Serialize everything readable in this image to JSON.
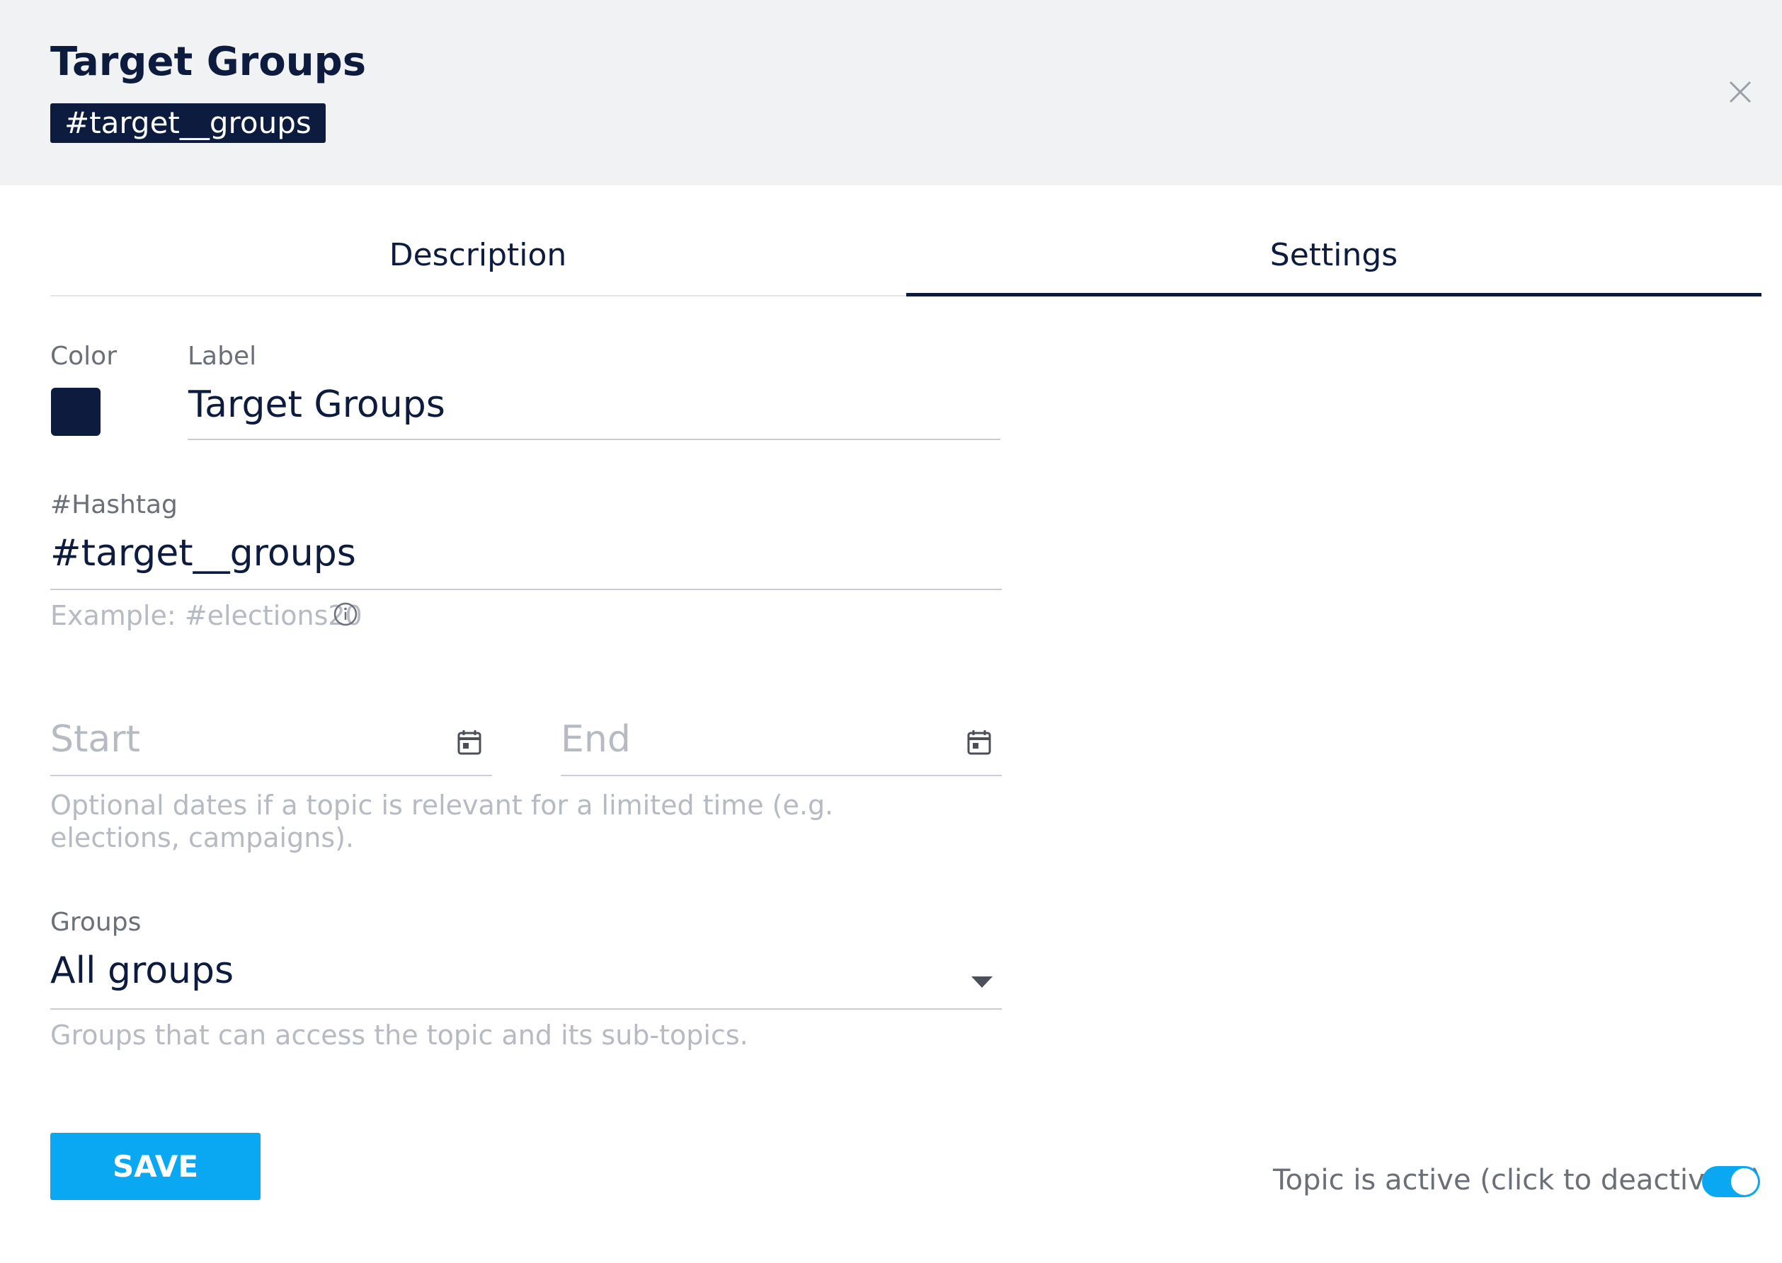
{
  "header": {
    "title": "Target Groups",
    "hashtag_chip": "#target__groups",
    "close_icon": "close-icon"
  },
  "tabs": [
    {
      "label": "Description",
      "active": false
    },
    {
      "label": "Settings",
      "active": true
    }
  ],
  "form": {
    "color": {
      "label": "Color",
      "value": "#0d1b3e"
    },
    "label_field": {
      "label": "Label",
      "value": "Target Groups"
    },
    "hashtag_field": {
      "label": "#Hashtag",
      "value": "#target__groups",
      "hint": "Example: #elections20",
      "hint_icon": "info-icon"
    },
    "dates": {
      "start_placeholder": "Start",
      "end_placeholder": "End",
      "icon": "calendar-icon",
      "hint": "Optional dates if a topic is relevant for a limited time (e.g. elections, campaigns)."
    },
    "groups_field": {
      "label": "Groups",
      "value": "All groups",
      "hint": "Groups that can access the topic and its sub-topics.",
      "icon": "chevron-down-icon"
    }
  },
  "footer": {
    "save_label": "SAVE",
    "active_text": "Topic is active (click to deactivate)",
    "toggle_on": true
  },
  "colors": {
    "navy": "#0d1b3e",
    "accent": "#0aa8f2",
    "header_bg": "#f1f2f4"
  }
}
